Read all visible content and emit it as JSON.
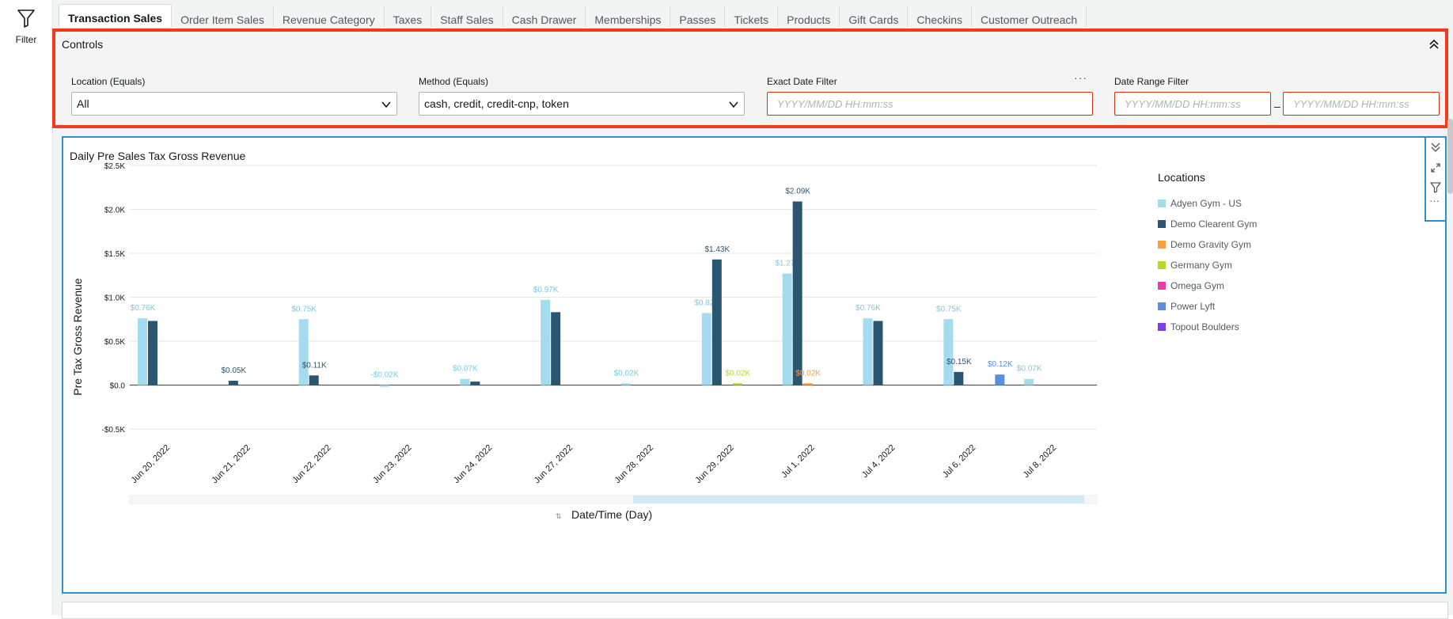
{
  "left_rail": {
    "filter_label": "Filter"
  },
  "tabs": [
    "Transaction Sales",
    "Order Item Sales",
    "Revenue Category",
    "Taxes",
    "Staff Sales",
    "Cash Drawer",
    "Memberships",
    "Passes",
    "Tickets",
    "Products",
    "Gift Cards",
    "Checkins",
    "Customer Outreach"
  ],
  "controls": {
    "title": "Controls",
    "location": {
      "label": "Location (Equals)",
      "value": "All"
    },
    "method": {
      "label": "Method (Equals)",
      "value": "cash, credit, credit-cnp, token"
    },
    "exact_date": {
      "label": "Exact Date Filter",
      "placeholder": "YYYY/MM/DD HH:mm:ss",
      "more": "···"
    },
    "date_range": {
      "label": "Date Range Filter",
      "start_placeholder": "YYYY/MM/DD HH:mm:ss",
      "end_placeholder": "YYYY/MM/DD HH:mm:ss",
      "separator": "–"
    }
  },
  "visual": {
    "title": "Daily Pre Sales Tax Gross Revenue",
    "more": "···",
    "legend_title": "Locations"
  },
  "chart_data": {
    "type": "bar",
    "title": "Daily Pre Sales Tax Gross Revenue",
    "xlabel": "Date/Time (Day)",
    "ylabel": "Pre Tax Gross Revenue",
    "ylim": [
      -0.5,
      2.5
    ],
    "y_unit_prefix": "$",
    "y_unit_suffix": "K",
    "yticks": [
      "$2.5K",
      "$2.0K",
      "$1.5K",
      "$1.0K",
      "$0.5K",
      "$0.0",
      "-$0.5K"
    ],
    "ytick_values": [
      2.5,
      2.0,
      1.5,
      1.0,
      0.5,
      0.0,
      -0.5
    ],
    "grid": true,
    "legend": "right",
    "categories": [
      "Jun 20, 2022",
      "Jun 21, 2022",
      "Jun 22, 2022",
      "Jun 23, 2022",
      "Jun 24, 2022",
      "Jun 27, 2022",
      "Jun 28, 2022",
      "Jun 29, 2022",
      "Jul 1, 2022",
      "Jul 4, 2022",
      "Jul 6, 2022",
      "Jul 8, 2022"
    ],
    "series": [
      {
        "name": "Adyen Gym - US",
        "color": "#a4dcef",
        "values": [
          0.76,
          null,
          0.75,
          -0.02,
          0.07,
          0.97,
          0.02,
          0.82,
          1.27,
          0.76,
          0.75,
          0.07
        ],
        "labels": [
          "$0.76K",
          "",
          "$0.75K",
          "-$0.02K",
          "$0.07K",
          "$0.97K",
          "$0.02K",
          "$0.82K",
          "$1.27K",
          "$0.76K",
          "$0.75K",
          "$0.07K"
        ]
      },
      {
        "name": "Demo Clearent Gym",
        "color": "#2b5671",
        "values": [
          0.73,
          0.05,
          0.11,
          null,
          0.04,
          0.83,
          null,
          1.43,
          2.09,
          0.73,
          0.15,
          null
        ],
        "labels": [
          "",
          "$0.05K",
          "$0.11K",
          "",
          "",
          "",
          "",
          "$1.43K",
          "$2.09K",
          "",
          "$0.15K",
          ""
        ]
      },
      {
        "name": "Demo Gravity Gym",
        "color": "#f89f3b",
        "values": [
          null,
          null,
          null,
          null,
          null,
          null,
          null,
          null,
          0.02,
          null,
          null,
          null
        ],
        "labels": [
          "",
          "",
          "",
          "",
          "",
          "",
          "",
          "",
          "$0.02K",
          "",
          "",
          ""
        ]
      },
      {
        "name": "Germany Gym",
        "color": "#b5d82c",
        "values": [
          null,
          null,
          null,
          null,
          null,
          null,
          null,
          0.02,
          null,
          null,
          null,
          null
        ],
        "labels": [
          "",
          "",
          "",
          "",
          "",
          "",
          "",
          "$0.02K",
          "",
          "",
          "",
          ""
        ]
      },
      {
        "name": "Omega Gym",
        "color": "#e83ca8",
        "values": [
          null,
          null,
          null,
          null,
          null,
          null,
          null,
          null,
          null,
          null,
          null,
          null
        ],
        "labels": [
          "",
          "",
          "",
          "",
          "",
          "",
          "",
          "",
          "",
          "",
          "",
          ""
        ]
      },
      {
        "name": "Power Lyft",
        "color": "#5c8ee0",
        "values": [
          null,
          null,
          null,
          null,
          null,
          null,
          null,
          null,
          null,
          null,
          0.12,
          null
        ],
        "labels": [
          "",
          "",
          "",
          "",
          "",
          "",
          "",
          "",
          "",
          "",
          "$0.12K",
          ""
        ]
      },
      {
        "name": "Topout Boulders",
        "color": "#7a3de8",
        "values": [
          null,
          null,
          null,
          null,
          null,
          null,
          null,
          null,
          null,
          null,
          null,
          null
        ],
        "labels": [
          "",
          "",
          "",
          "",
          "",
          "",
          "",
          "",
          "",
          "",
          "",
          ""
        ]
      }
    ]
  }
}
